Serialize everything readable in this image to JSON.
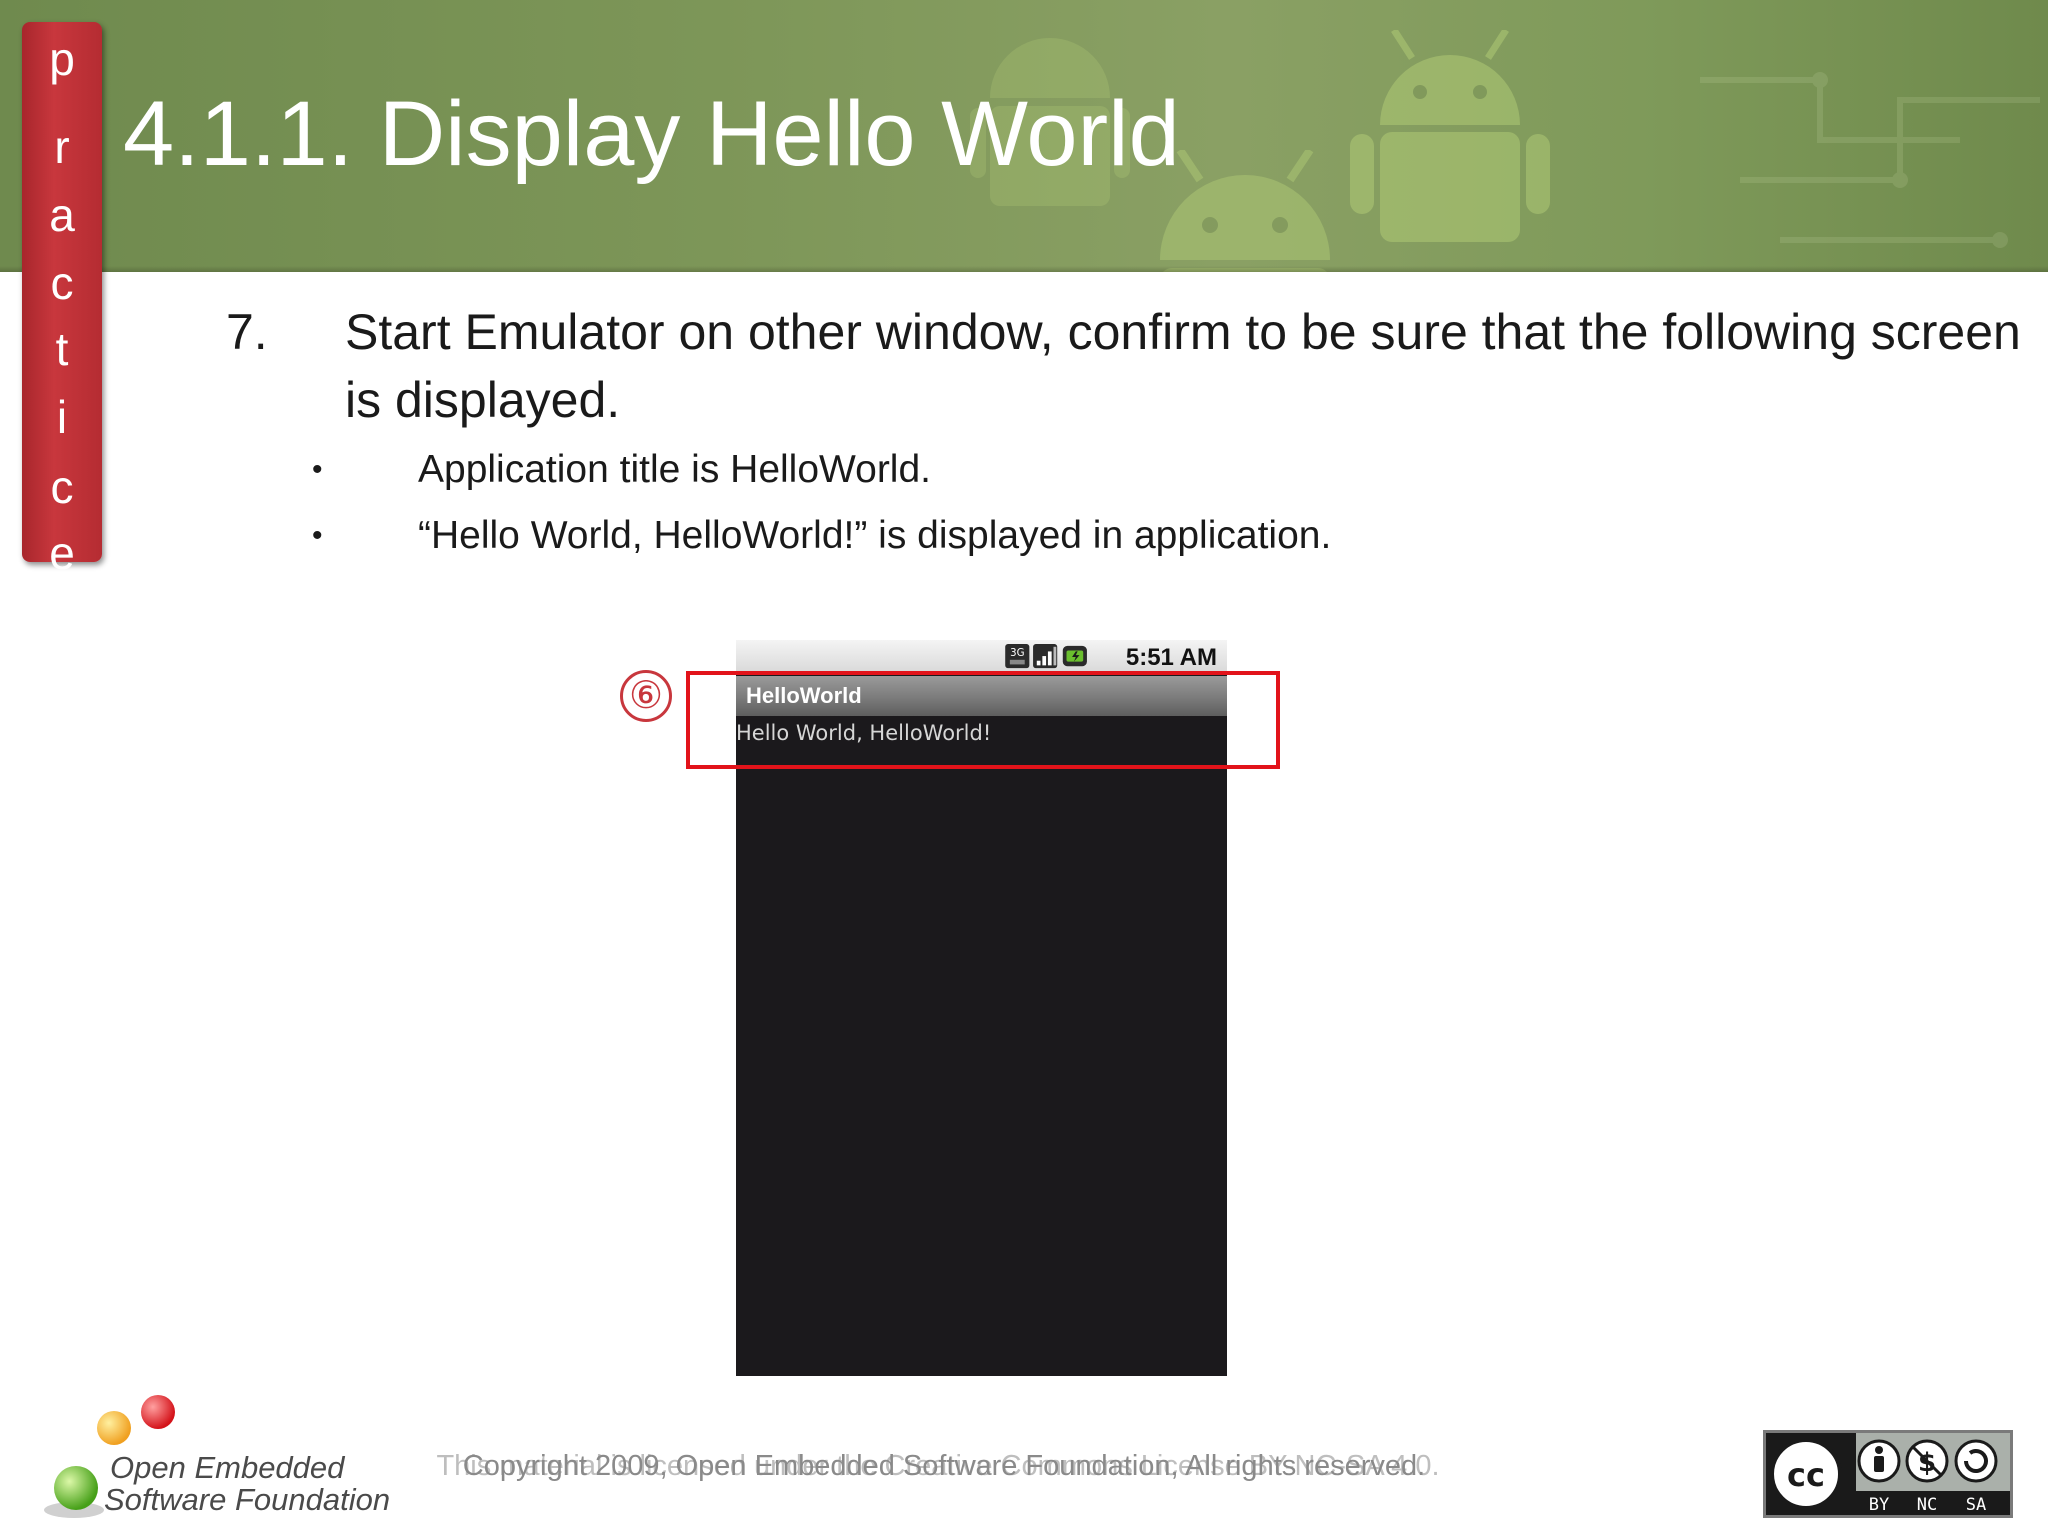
{
  "slide": {
    "title": "4.1.1. Display Hello World",
    "tab_letters": [
      "p",
      "r",
      "a",
      "c",
      "t",
      "i",
      "c",
      "e"
    ]
  },
  "step": {
    "number": "7.",
    "text": "Start Emulator on other window, confirm to be sure that the following screen is displayed.",
    "bullets": [
      {
        "marker": "•",
        "text": "Application title is HelloWorld."
      },
      {
        "marker": "•",
        "text": "“Hello World, HelloWorld!” is displayed in application."
      }
    ]
  },
  "callout": {
    "label": "⑥"
  },
  "phone": {
    "status_time": "5:51 AM",
    "status_icons": [
      "3g-icon",
      "signal-icon",
      "battery-icon"
    ],
    "app_title": "HelloWorld",
    "app_text": "Hello World, HelloWorld!"
  },
  "footer": {
    "logo_line1": "Open Embedded",
    "logo_line2": "Software Foundation",
    "copyright_a": "Copyright 2009, Open Embedded Software Foundation, All rights reserved.",
    "copyright_b": "This material is licensed under the Creative Commons License BY-NC-SA 4.0.",
    "license_labels": [
      "cc",
      "BY",
      "NC",
      "SA"
    ]
  },
  "colors": {
    "banner_green": "#7d9658",
    "practice_red": "#c8373d",
    "highlight_red": "#e2131a",
    "phone_background": "#1b191c"
  }
}
